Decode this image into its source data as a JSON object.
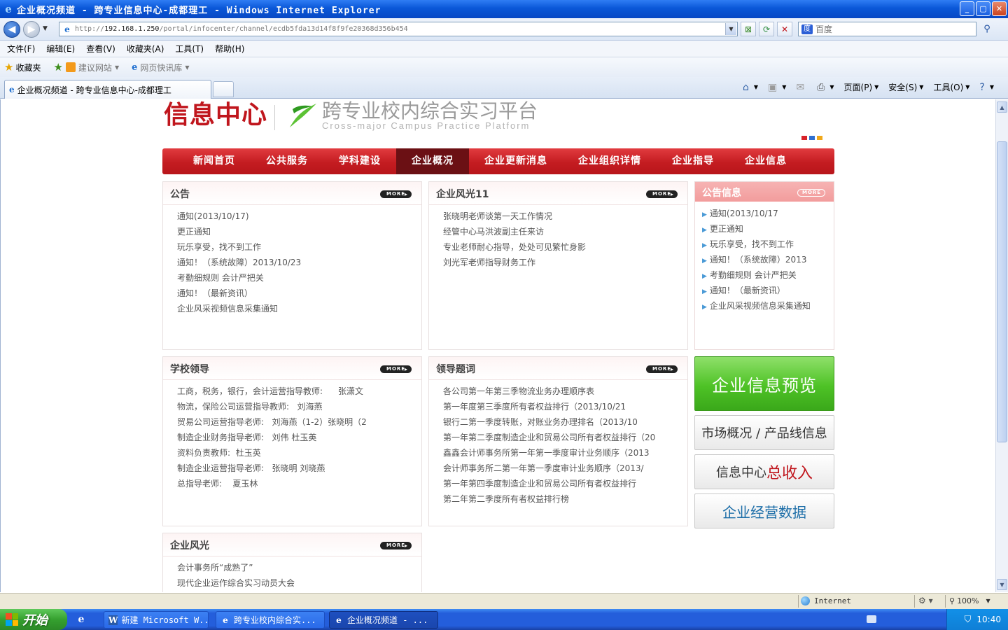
{
  "window": {
    "title": "企业概况频道 - 跨专业信息中心-成都理工 - Windows Internet Explorer",
    "buttons": {
      "minimize": "_",
      "maximize": "▢",
      "close": "✕"
    }
  },
  "address": {
    "url_prefix": "http://",
    "url_host": "192.168.1.250",
    "url_path": "/portal/infocenter/channel/ecdb5fda13d14f8f9fe20368d356b454",
    "search_placeholder": "百度"
  },
  "menu": [
    "文件(F)",
    "编辑(E)",
    "查看(V)",
    "收藏夹(A)",
    "工具(T)",
    "帮助(H)"
  ],
  "favorites": {
    "label": "收藏夹",
    "items": [
      "建议网站",
      "网页快讯库"
    ]
  },
  "tab": {
    "title": "企业概况频道 - 跨专业信息中心-成都理工"
  },
  "commands": {
    "page": "页面(P)",
    "safety": "安全(S)",
    "tools": "工具(O)"
  },
  "site": {
    "logo_cn": "信息中心",
    "logo_platform": "跨专业校内综合实习平台",
    "logo_en": "Cross-major Campus Practice Platform",
    "dot_colors": [
      "#d8232a",
      "#2f6fd0",
      "#f0a81a"
    ],
    "nav": [
      "新闻首页",
      "公共服务",
      "学科建设",
      "企业概况",
      "企业更新消息",
      "企业组织详情",
      "企业指导",
      "企业信息"
    ],
    "nav_active": 3,
    "more": "MORE"
  },
  "panels": {
    "notice": {
      "title": "公告",
      "items": [
        "通知(2013/10/17)",
        "更正通知",
        "玩乐享受，找不到工作",
        "通知！（系统故障）2013/10/23",
        "考勤细规则 会计严把关",
        "通知！（最新资讯）",
        "企业风采视频信息采集通知"
      ]
    },
    "scenery": {
      "title": "企业风光11",
      "items": [
        "张晓明老师谈第一天工作情况",
        "经管中心马洪波副主任来访",
        "专业老师耐心指导，处处可见繁忙身影",
        "刘光军老师指导财务工作"
      ]
    },
    "side": {
      "title": "公告信息",
      "items": [
        "通知(2013/10/17",
        "更正通知",
        "玩乐享受，找不到工作",
        "通知！（系统故障）2013",
        "考勤细规则 会计严把关",
        "通知！（最新资讯）",
        "企业风采视频信息采集通知"
      ]
    },
    "leaders": {
      "title": "学校领导",
      "items": [
        {
          "a": "工商，税务，银行，会计运营指导教师:",
          "b": "张潇文"
        },
        {
          "a": "物流，保险公司运营指导教师:",
          "b": "刘海燕"
        },
        {
          "a": "贸易公司运营指导老师:",
          "b": "刘海燕（1-2）张晓明（2"
        },
        {
          "a": "制造企业财务指导老师:",
          "b": "刘伟 杜玉英"
        },
        {
          "a": "资料负责教师:",
          "b": "杜玉英"
        },
        {
          "a": "制造企业运营指导老师:",
          "b": "张晓明 刘晓燕"
        },
        {
          "a": "总指导老师:",
          "b": "夏玉林"
        }
      ]
    },
    "inscription": {
      "title": "领导题词",
      "items": [
        "各公司第一年第三季物流业务办理顺序表",
        "第一年度第三季度所有者权益排行（2013/10/21",
        "银行二第一季度转账，对账业务办理排名（2013/10",
        "第一年第二季度制造企业和贸易公司所有者权益排行（20",
        "鑫鑫会计师事务所第一年第一季度审计业务顺序（2013",
        "会计师事务所二第一年第一季度审计业务顺序（2013/",
        "第一年第四季度制造企业和贸易公司所有者权益排行",
        "第二年第二季度所有者权益排行榜"
      ]
    },
    "style": {
      "title": "企业风光",
      "items": [
        "会计事务所“成熟了”",
        "现代企业运作综合实习动员大会"
      ]
    }
  },
  "buttons": {
    "preview": "企业信息预览",
    "market": "市场概况 / 产品线信息",
    "income_prefix": "信息中心",
    "income_emph": "总收入",
    "data": "企业经营数据"
  },
  "status": {
    "zone": "Internet",
    "zoom": "100%"
  },
  "taskbar": {
    "start": "开始",
    "items": [
      "新建 Microsoft W...",
      "跨专业校内综合实...",
      "企业概况频道 - ..."
    ],
    "time": "10:40"
  }
}
